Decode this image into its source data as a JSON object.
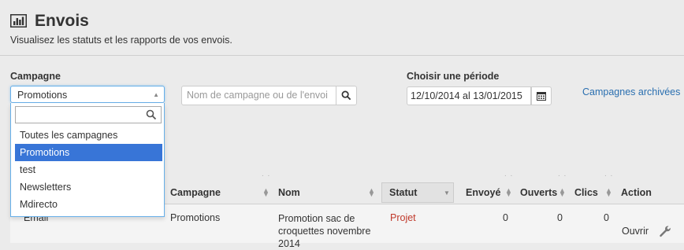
{
  "header": {
    "title": "Envois",
    "subtitle": "Visualisez les statuts et les rapports de vos envois.",
    "icon": "bar-chart-icon"
  },
  "filters": {
    "campaign_label": "Campagne",
    "campaign_selected": "Promotions",
    "campaign_options": [
      "Toutes les campagnes",
      "Promotions",
      "test",
      "Newsletters",
      "Mdirecto"
    ],
    "search_placeholder": "Nom de campagne ou de l'envoi",
    "period_label": "Choisir une période",
    "period_value": "12/10/2014 al 13/01/2015",
    "archived_link": "Campagnes archivées"
  },
  "table": {
    "headers": [
      "Campagne",
      "Nom",
      "Statut",
      "Envoyé",
      "Ouverts",
      "Clics",
      "Action"
    ],
    "dots": ". .",
    "row": {
      "type": "Email",
      "campaign": "Promotions",
      "name_lines": [
        "Promotion sac de",
        "croquettes novembre",
        "2014"
      ],
      "status": "Projet",
      "sent": "0",
      "opened": "0",
      "clicks": "0",
      "action": "Ouvrir"
    }
  },
  "colors": {
    "accent": "#2a6fb0",
    "selected": "#3875d7",
    "status_draft": "#c0392b"
  }
}
